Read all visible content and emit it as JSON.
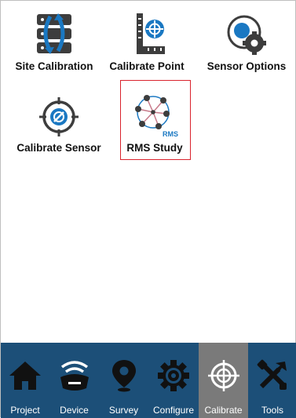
{
  "tiles": [
    {
      "label": "Site Calibration",
      "icon": "site-calibration-icon"
    },
    {
      "label": "Calibrate Point",
      "icon": "calibrate-point-icon"
    },
    {
      "label": "Sensor Options",
      "icon": "sensor-options-icon"
    },
    {
      "label": "Calibrate Sensor",
      "icon": "calibrate-sensor-icon"
    },
    {
      "label": "RMS Study",
      "icon": "rms-study-icon",
      "icon_text": "RMS",
      "selected": true
    }
  ],
  "tabs": [
    {
      "label": "Project",
      "icon": "home-icon"
    },
    {
      "label": "Device",
      "icon": "gnss-receiver-icon"
    },
    {
      "label": "Survey",
      "icon": "map-pin-icon"
    },
    {
      "label": "Configure",
      "icon": "gear-icon"
    },
    {
      "label": "Calibrate",
      "icon": "crosshair-icon",
      "active": true
    },
    {
      "label": "Tools",
      "icon": "tools-icon"
    }
  ],
  "colors": {
    "bar": "#1c4f78",
    "active_tab": "#7a7a7a",
    "selection": "#d9232d",
    "icon_blue": "#1a78c2",
    "icon_dark": "#3d3d3d"
  }
}
